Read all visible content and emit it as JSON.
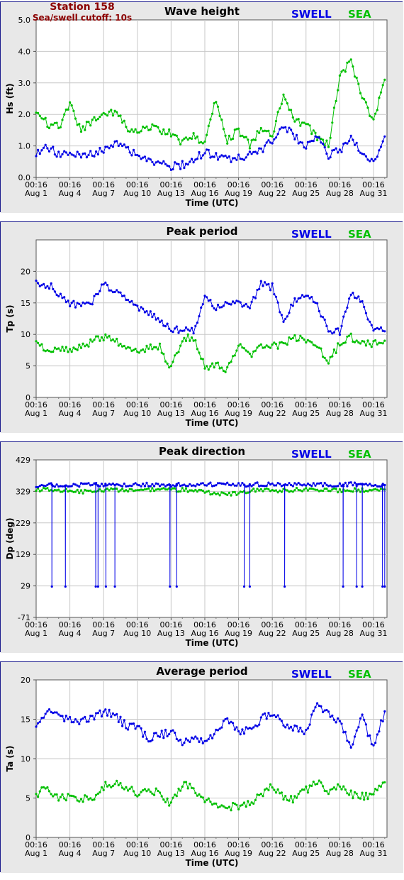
{
  "station": {
    "name": "Station 158",
    "cutoff": "Sea/swell cutoff: 10s"
  },
  "colors": {
    "swell": "#0000e6",
    "sea": "#00c000",
    "frame": "#1a1a8c",
    "plot_bg": "#ffffff",
    "outer_bg": "#e8e8e8",
    "station_text": "#8b0000"
  },
  "chart_data": [
    {
      "type": "line",
      "title": "Wave height",
      "xlabel": "Time (UTC)",
      "ylabel": "Hs (ft)",
      "ylim": [
        0,
        5
      ],
      "yticks": [
        "0.0",
        "1.0",
        "2.0",
        "3.0",
        "4.0",
        "5.0"
      ],
      "grid": true,
      "legend": "top-right",
      "x_ticks": [
        {
          "time": "00:16",
          "date": "Aug 1"
        },
        {
          "time": "00:16",
          "date": "Aug 4"
        },
        {
          "time": "00:16",
          "date": "Aug 7"
        },
        {
          "time": "00:16",
          "date": "Aug 10"
        },
        {
          "time": "00:16",
          "date": "Aug 13"
        },
        {
          "time": "00:16",
          "date": "Aug 16"
        },
        {
          "time": "00:16",
          "date": "Aug 19"
        },
        {
          "time": "00:16",
          "date": "Aug 22"
        },
        {
          "time": "00:16",
          "date": "Aug 25"
        },
        {
          "time": "00:16",
          "date": "Aug 28"
        },
        {
          "time": "00:16",
          "date": "Aug 31"
        }
      ],
      "x": [
        "Aug 1",
        "Aug 2",
        "Aug 3",
        "Aug 4",
        "Aug 5",
        "Aug 6",
        "Aug 7",
        "Aug 8",
        "Aug 9",
        "Aug 10",
        "Aug 11",
        "Aug 12",
        "Aug 13",
        "Aug 14",
        "Aug 15",
        "Aug 16",
        "Aug 17",
        "Aug 18",
        "Aug 19",
        "Aug 20",
        "Aug 21",
        "Aug 22",
        "Aug 23",
        "Aug 24",
        "Aug 25",
        "Aug 26",
        "Aug 27",
        "Aug 28",
        "Aug 29",
        "Aug 30",
        "Aug 31",
        "Sep 1"
      ],
      "series": [
        {
          "name": "SWELL",
          "values": [
            0.8,
            0.95,
            0.75,
            0.7,
            0.7,
            0.75,
            0.9,
            1.05,
            0.95,
            0.7,
            0.6,
            0.45,
            0.35,
            0.4,
            0.55,
            0.8,
            0.65,
            0.6,
            0.6,
            0.7,
            0.85,
            1.2,
            1.6,
            1.3,
            1.0,
            1.3,
            0.7,
            0.85,
            1.3,
            0.7,
            0.45,
            1.3
          ]
        },
        {
          "name": "SEA",
          "values": [
            2.1,
            1.7,
            1.6,
            2.3,
            1.5,
            1.8,
            2.0,
            2.1,
            1.6,
            1.4,
            1.6,
            1.5,
            1.4,
            1.1,
            1.3,
            1.1,
            2.5,
            1.2,
            1.5,
            1.0,
            1.6,
            1.3,
            2.6,
            1.8,
            1.7,
            1.3,
            1.0,
            3.2,
            3.7,
            2.5,
            1.8,
            3.1
          ]
        }
      ]
    },
    {
      "type": "line",
      "title": "Peak period",
      "xlabel": "Time (UTC)",
      "ylabel": "Tp (s)",
      "ylim": [
        0,
        25
      ],
      "yticks": [
        "0",
        "5",
        "10",
        "15",
        "20"
      ],
      "grid": true,
      "legend": "top-right",
      "x": [
        "Aug 1",
        "Aug 2",
        "Aug 3",
        "Aug 4",
        "Aug 5",
        "Aug 6",
        "Aug 7",
        "Aug 8",
        "Aug 9",
        "Aug 10",
        "Aug 11",
        "Aug 12",
        "Aug 13",
        "Aug 14",
        "Aug 15",
        "Aug 16",
        "Aug 17",
        "Aug 18",
        "Aug 19",
        "Aug 20",
        "Aug 21",
        "Aug 22",
        "Aug 23",
        "Aug 24",
        "Aug 25",
        "Aug 26",
        "Aug 27",
        "Aug 28",
        "Aug 29",
        "Aug 30",
        "Aug 31",
        "Sep 1"
      ],
      "series": [
        {
          "name": "SWELL",
          "values": [
            18,
            18,
            16.5,
            15,
            14.5,
            15,
            18,
            17,
            15.5,
            14.5,
            13.5,
            12,
            11,
            10.5,
            10.5,
            16,
            14,
            15,
            15.5,
            14,
            18,
            17.5,
            12,
            15.5,
            16.5,
            14.5,
            10.5,
            10.5,
            16.5,
            15,
            10.5,
            10.5
          ]
        },
        {
          "name": "SEA",
          "values": [
            8.5,
            7.5,
            8,
            7.5,
            8,
            9,
            9.5,
            9,
            8,
            7.5,
            8,
            8,
            4.5,
            9.5,
            9.5,
            5,
            5,
            4.5,
            8.5,
            6.5,
            8.5,
            8,
            8.5,
            9.5,
            9,
            8.5,
            5.5,
            8.5,
            9.5,
            9,
            8.5,
            9
          ]
        }
      ]
    },
    {
      "type": "line",
      "title": "Peak direction",
      "xlabel": "Time (UTC)",
      "ylabel": "Dp (deg)",
      "ylim": [
        -71,
        429
      ],
      "yticks": [
        "-71",
        "29",
        "129",
        "229",
        "329",
        "429"
      ],
      "grid": true,
      "legend": "top-right",
      "x": [
        "Aug 1",
        "Aug 2",
        "Aug 3",
        "Aug 4",
        "Aug 5",
        "Aug 6",
        "Aug 7",
        "Aug 8",
        "Aug 9",
        "Aug 10",
        "Aug 11",
        "Aug 12",
        "Aug 13",
        "Aug 14",
        "Aug 15",
        "Aug 16",
        "Aug 17",
        "Aug 18",
        "Aug 19",
        "Aug 20",
        "Aug 21",
        "Aug 22",
        "Aug 23",
        "Aug 24",
        "Aug 25",
        "Aug 26",
        "Aug 27",
        "Aug 28",
        "Aug 29",
        "Aug 30",
        "Aug 31",
        "Sep 1"
      ],
      "series": [
        {
          "name": "SWELL",
          "values": [
            348,
            350,
            349,
            347,
            350,
            352,
            348,
            349,
            350,
            350,
            351,
            350,
            349,
            352,
            350,
            350,
            352,
            351,
            350,
            350,
            352,
            351,
            350,
            351,
            352,
            351,
            350,
            350,
            352,
            351,
            350,
            349
          ],
          "spikes": [
            {
              "x": 1.4,
              "y": 27
            },
            {
              "x": 2.6,
              "y": 27
            },
            {
              "x": 5.3,
              "y": 27
            },
            {
              "x": 5.5,
              "y": 27
            },
            {
              "x": 6.2,
              "y": 27
            },
            {
              "x": 7.0,
              "y": 27
            },
            {
              "x": 11.9,
              "y": 27
            },
            {
              "x": 12.5,
              "y": 27
            },
            {
              "x": 18.5,
              "y": 27
            },
            {
              "x": 19.0,
              "y": 27
            },
            {
              "x": 22.1,
              "y": 27
            },
            {
              "x": 27.3,
              "y": 27
            },
            {
              "x": 28.5,
              "y": 27
            },
            {
              "x": 29.0,
              "y": 27
            },
            {
              "x": 30.8,
              "y": 27
            },
            {
              "x": 31.0,
              "y": 27
            }
          ]
        },
        {
          "name": "SEA",
          "values": [
            334,
            335,
            330,
            332,
            328,
            329,
            334,
            333,
            333,
            334,
            335,
            334,
            333,
            334,
            333,
            328,
            321,
            320,
            322,
            331,
            333,
            331,
            332,
            334,
            335,
            336,
            333,
            332,
            334,
            333,
            336,
            335
          ]
        }
      ]
    },
    {
      "type": "line",
      "title": "Average period",
      "xlabel": "Time (UTC)",
      "ylabel": "Ta (s)",
      "ylim": [
        0,
        20
      ],
      "yticks": [
        "0",
        "5",
        "10",
        "15",
        "20"
      ],
      "grid": true,
      "legend": "top-right",
      "x": [
        "Aug 1",
        "Aug 2",
        "Aug 3",
        "Aug 4",
        "Aug 5",
        "Aug 6",
        "Aug 7",
        "Aug 8",
        "Aug 9",
        "Aug 10",
        "Aug 11",
        "Aug 12",
        "Aug 13",
        "Aug 14",
        "Aug 15",
        "Aug 16",
        "Aug 17",
        "Aug 18",
        "Aug 19",
        "Aug 20",
        "Aug 21",
        "Aug 22",
        "Aug 23",
        "Aug 24",
        "Aug 25",
        "Aug 26",
        "Aug 27",
        "Aug 28",
        "Aug 29",
        "Aug 30",
        "Aug 31",
        "Sep 1"
      ],
      "series": [
        {
          "name": "SWELL",
          "values": [
            14,
            16.2,
            15.3,
            15,
            14.8,
            15.2,
            16,
            15.5,
            14.2,
            14,
            12.5,
            13,
            13.3,
            12.2,
            12.5,
            12.2,
            13.5,
            15,
            13.5,
            13.8,
            15,
            15.8,
            14.5,
            13.8,
            13.5,
            16.8,
            15.8,
            14.5,
            11.5,
            15.3,
            11.2,
            16
          ]
        },
        {
          "name": "SEA",
          "values": [
            5.5,
            6.2,
            5,
            5.2,
            5,
            4.8,
            6.5,
            6.8,
            6.5,
            5.5,
            6.2,
            5.5,
            4.2,
            6.8,
            6.2,
            4.8,
            4.2,
            4,
            3.8,
            4.2,
            5.5,
            6.5,
            5,
            4.8,
            6,
            7,
            5.5,
            6.8,
            5.5,
            5.2,
            5.5,
            7
          ]
        }
      ]
    }
  ]
}
